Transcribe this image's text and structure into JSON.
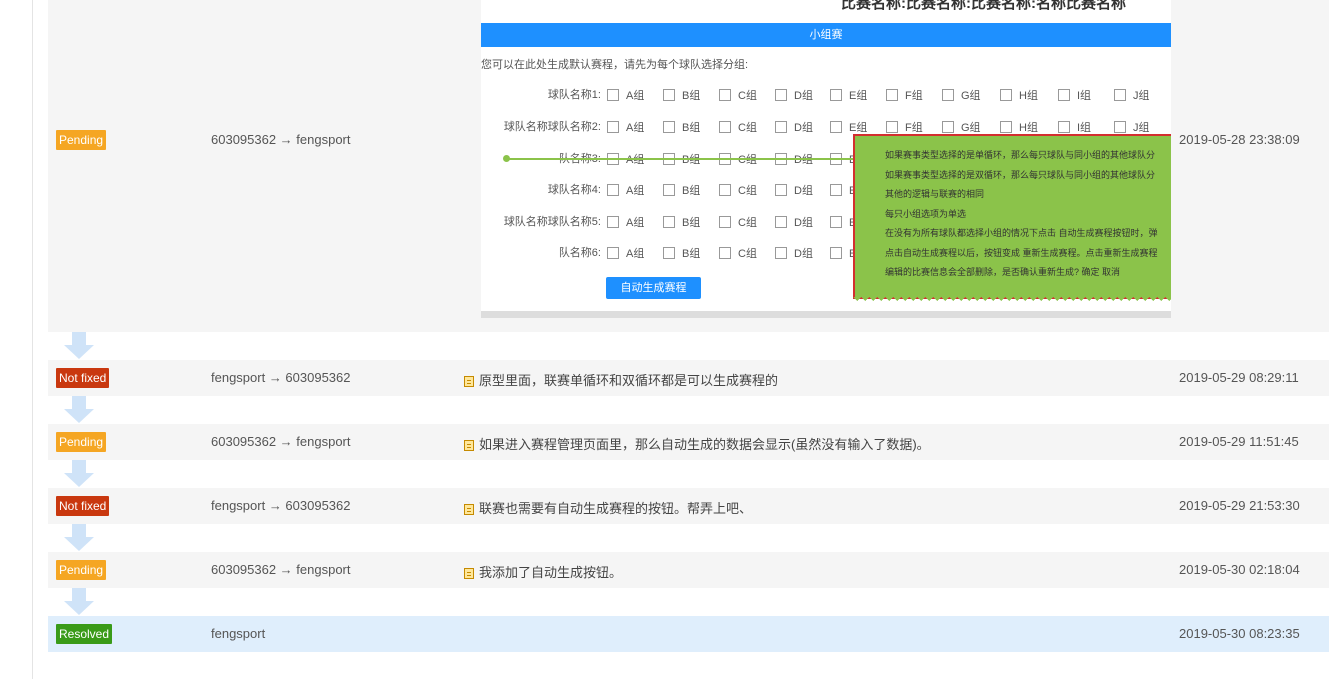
{
  "colors": {
    "pending": "#f5a623",
    "not_fixed": "#c9380f",
    "resolved": "#3a9b18",
    "arrow": "#cfe3f8"
  },
  "history": [
    {
      "status": "Pending",
      "from_to": "603095362 → fengsport",
      "note": "",
      "time": "2019-05-28 23:38:09"
    },
    {
      "status": "Not fixed",
      "from_to": "fengsport → 603095362",
      "note": "原型里面，联赛单循环和双循环都是可以生成赛程的",
      "time": "2019-05-29 08:29:11"
    },
    {
      "status": "Pending",
      "from_to": "603095362 → fengsport",
      "note": "如果进入赛程管理页面里，那么自动生成的数据会显示(虽然没有输入了数据)。",
      "time": "2019-05-29 11:51:45"
    },
    {
      "status": "Not fixed",
      "from_to": "fengsport → 603095362",
      "note": "联赛也需要有自动生成赛程的按钮。帮弄上吧、",
      "time": "2019-05-29 21:53:30"
    },
    {
      "status": "Pending",
      "from_to": "603095362 → fengsport",
      "note": "我添加了自动生成按钮。",
      "time": "2019-05-30 02:18:04"
    },
    {
      "status": "Resolved",
      "from_to": "fengsport",
      "note": "",
      "time": "2019-05-30 08:23:35"
    }
  ],
  "attachment": {
    "cut_title": "比赛名称:比赛名称:比赛名称:名称比赛名称",
    "bar_label": "小组赛",
    "intro": "您可以在此处生成默认赛程，请先为每个球队选择分组:",
    "groups": [
      "A组",
      "B组",
      "C组",
      "D组",
      "E组",
      "F组",
      "G组",
      "H组",
      "I组",
      "J组"
    ],
    "teams": [
      "球队名称1:",
      "球队名称球队名称2:",
      "队名称3:",
      "球队名称4:",
      "球队名称球队名称5:",
      "队名称6:"
    ],
    "button": "自动生成赛程",
    "tip_lines": [
      "如果赛事类型选择的是单循环，那么每只球队与同小组的其他球队分",
      "如果赛事类型选择的是双循环，那么每只球队与同小组的其他球队分",
      "其他的逻辑与联赛的相同",
      "每只小组选项为单选",
      "在没有为所有球队都选择小组的情况下点击 自动生成赛程按钮时，弹",
      "点击自动生成赛程以后，按钮变成 重新生成赛程。点击重新生成赛程",
      "编辑的比赛信息会全部删除，是否确认重新生成?      确定    取消"
    ]
  }
}
